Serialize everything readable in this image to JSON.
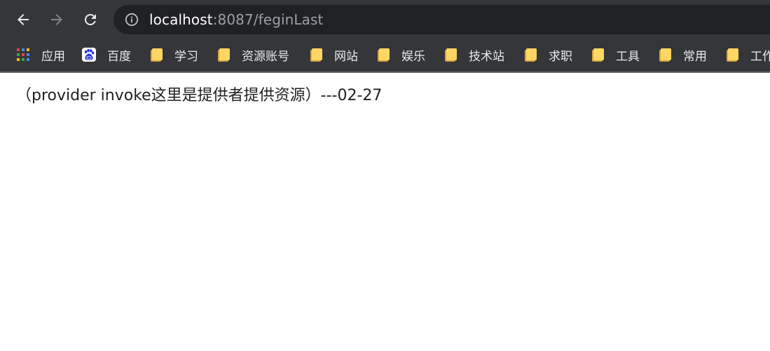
{
  "address_bar": {
    "host": "localhost",
    "path": ":8087/feginLast"
  },
  "bookmarks": [
    {
      "label": "应用",
      "icon": "apps-grid-icon"
    },
    {
      "label": "百度",
      "icon": "baidu-icon"
    },
    {
      "label": "学习",
      "icon": "folder-icon"
    },
    {
      "label": "资源账号",
      "icon": "folder-icon"
    },
    {
      "label": "网站",
      "icon": "folder-icon"
    },
    {
      "label": "娱乐",
      "icon": "folder-icon"
    },
    {
      "label": "技术站",
      "icon": "folder-icon"
    },
    {
      "label": "求职",
      "icon": "folder-icon"
    },
    {
      "label": "工具",
      "icon": "folder-icon"
    },
    {
      "label": "常用",
      "icon": "folder-icon"
    },
    {
      "label": "工作",
      "icon": "folder-icon"
    }
  ],
  "page": {
    "body_text": "（provider invoke这里是提供者提供资源）---02-27"
  },
  "colors": {
    "toolbar_bg": "#35363a",
    "omnibox_bg": "#202124",
    "folder": "#fdd663"
  }
}
